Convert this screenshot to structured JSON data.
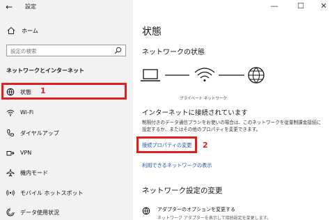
{
  "window": {
    "title": "設定",
    "back_glyph": "←",
    "minimize_glyph": "—",
    "maximize_glyph": "☐",
    "close_glyph": "✕"
  },
  "sidebar": {
    "home_label": "ホーム",
    "search_placeholder": "設定の検索",
    "section_title": "ネットワークとインターネット",
    "items": [
      {
        "label": "状態",
        "icon": "globe-status-icon"
      },
      {
        "label": "Wi-Fi",
        "icon": "wifi-icon"
      },
      {
        "label": "ダイヤルアップ",
        "icon": "phone-icon"
      },
      {
        "label": "VPN",
        "icon": "vpn-icon"
      },
      {
        "label": "機内モード",
        "icon": "airplane-icon"
      },
      {
        "label": "モバイル ホットスポット",
        "icon": "hotspot-icon"
      },
      {
        "label": "データ使用状況",
        "icon": "data-usage-icon"
      }
    ]
  },
  "annotations": {
    "callout_1": "1",
    "callout_2": "2",
    "accent_color": "#e02020"
  },
  "main": {
    "page_title": "状態",
    "network_status_title": "ネットワークの状態",
    "network_caption": "プライベート ネットワーク",
    "connected_heading": "インターネットに接続されています",
    "connected_desc": "制限付きのデータ通信プランをお使いの場合は、このネットワークを従量制課金接続に設定するか、またはその他のプロパティを変更できます。",
    "change_props_link": "接続プロパティの変更",
    "show_networks_link": "利用できるネットワークの表示",
    "settings_title": "ネットワーク設定の変更",
    "adapter_label": "アダプターのオプションを変更する",
    "adapter_sub": "ネットワーク アダプターを表示して接続設定を変更します。",
    "link_color": "#1a57a8"
  }
}
